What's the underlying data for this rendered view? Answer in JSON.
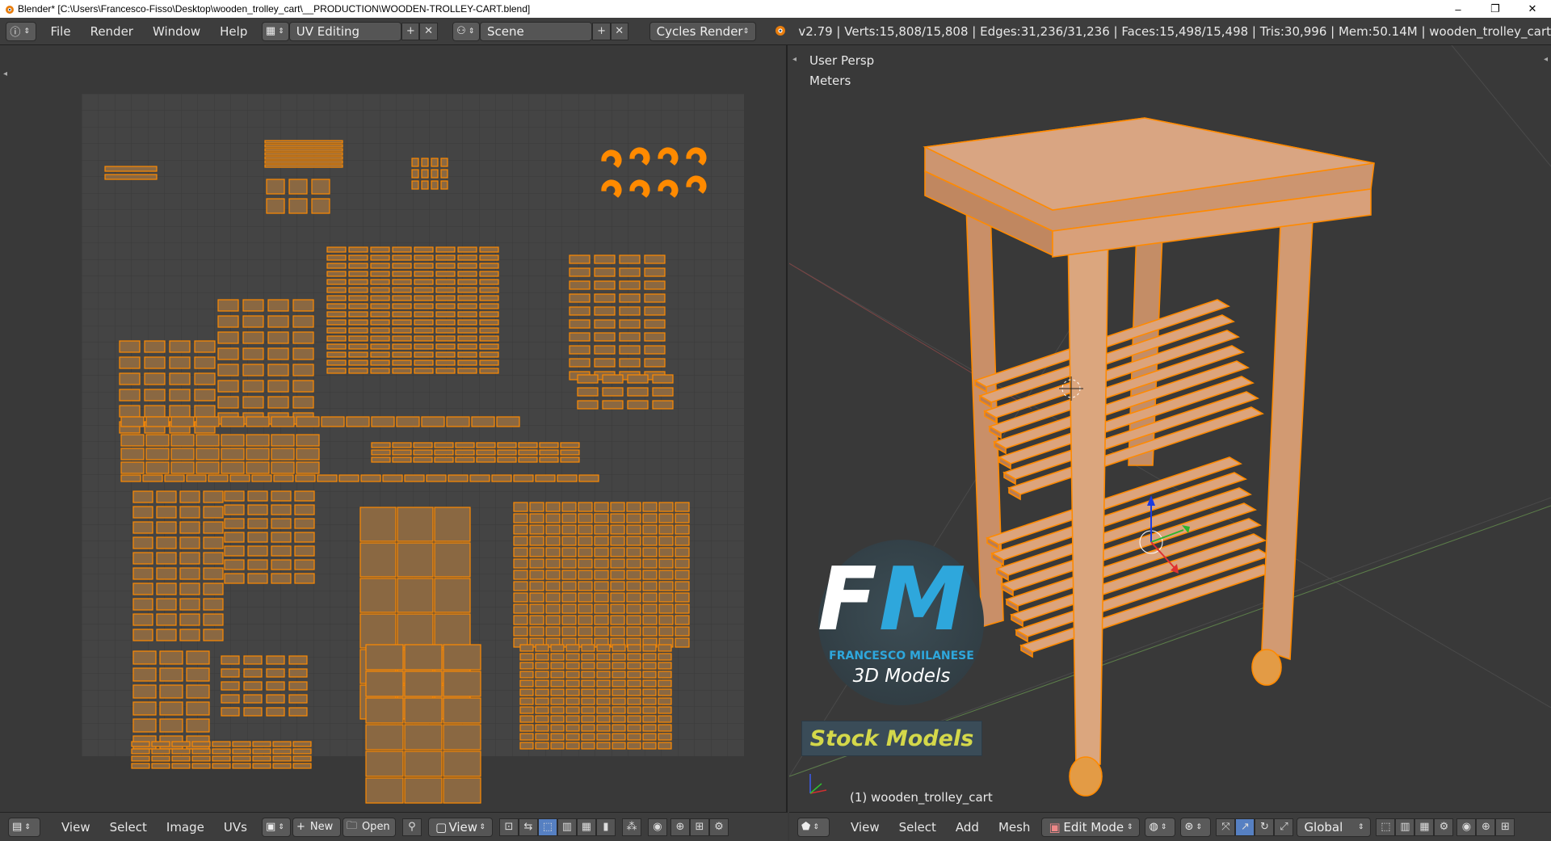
{
  "window": {
    "title": "Blender* [C:\\Users\\Francesco-Fisso\\Desktop\\wooden_trolley_cart\\__PRODUCTION\\WOODEN-TROLLEY-CART.blend]",
    "minimize": "–",
    "maximize": "❐",
    "close": "✕"
  },
  "infobar": {
    "menu": [
      "File",
      "Render",
      "Window",
      "Help"
    ],
    "layout": "UV Editing",
    "scene": "Scene",
    "engine": "Cycles Render",
    "stats": "v2.79 | Verts:15,808/15,808 | Edges:31,236/31,236 | Faces:15,498/15,498 | Tris:30,996 | Mem:50.14M | wooden_trolley_cart"
  },
  "viewport": {
    "view_name": "User Persp",
    "units": "Meters",
    "object_label": "(1) wooden_trolley_cart"
  },
  "watermark": {
    "monogram_f": "F",
    "monogram_m": "M",
    "author": "FRANCESCO MILANESE",
    "tagline": "3D Models",
    "banner": "Stock Models"
  },
  "uv_footer": {
    "menu": [
      "View",
      "Select",
      "Image",
      "UVs"
    ],
    "new_label": "New",
    "open_label": "Open",
    "view_label": "View"
  },
  "v3d_footer": {
    "menu": [
      "View",
      "Select",
      "Add",
      "Mesh"
    ],
    "mode": "Edit Mode",
    "orientation": "Global"
  },
  "colors": {
    "accent": "#ff8a00",
    "uv_fill": "#8a6842",
    "wood": "#d9a27a"
  }
}
